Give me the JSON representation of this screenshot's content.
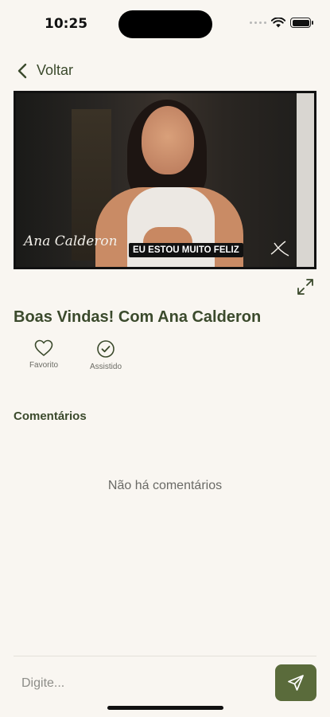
{
  "status_bar": {
    "time": "10:25"
  },
  "nav": {
    "back_label": "Voltar"
  },
  "video": {
    "signature_text": "Ana Calderon",
    "caption": "EU ESTOU MUITO FELIZ"
  },
  "lesson": {
    "title": "Boas Vindas! Com Ana Calderon",
    "actions": [
      {
        "label": "Favorito",
        "icon": "heart-icon"
      },
      {
        "label": "Assistido",
        "icon": "check-circle-icon"
      }
    ]
  },
  "comments": {
    "heading": "Comentários",
    "empty_text": "Não há comentários"
  },
  "composer": {
    "placeholder": "Digite..."
  },
  "colors": {
    "accent": "#5a6b3b",
    "text": "#3b4a2c",
    "background": "#f9f6f1"
  }
}
